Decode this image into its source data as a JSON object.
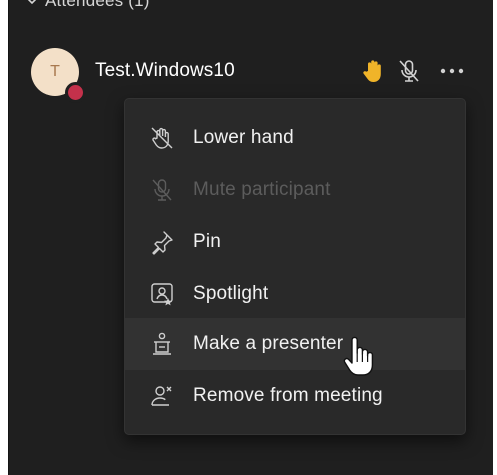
{
  "section": {
    "title": "Attendees (1)"
  },
  "attendee": {
    "initial": "T",
    "name": "Test.Windows10",
    "icons": [
      "raised-hand-icon",
      "mic-off-icon",
      "more-options-icon"
    ]
  },
  "menu": {
    "items": [
      {
        "label": "Lower hand",
        "icon": "lower-hand-icon",
        "enabled": true
      },
      {
        "label": "Mute participant",
        "icon": "mic-off-icon",
        "enabled": false
      },
      {
        "label": "Pin",
        "icon": "pin-icon",
        "enabled": true
      },
      {
        "label": "Spotlight",
        "icon": "spotlight-icon",
        "enabled": true
      },
      {
        "label": "Make a presenter",
        "icon": "presenter-icon",
        "enabled": true,
        "hovered": true
      },
      {
        "label": "Remove from meeting",
        "icon": "remove-person-icon",
        "enabled": true
      }
    ]
  },
  "colors": {
    "panel_bg": "#1f1f1f",
    "menu_bg": "#292929",
    "hand_accent": "#f0b429",
    "presence_busy": "#c4314b",
    "avatar_bg": "#f3e0c8"
  }
}
